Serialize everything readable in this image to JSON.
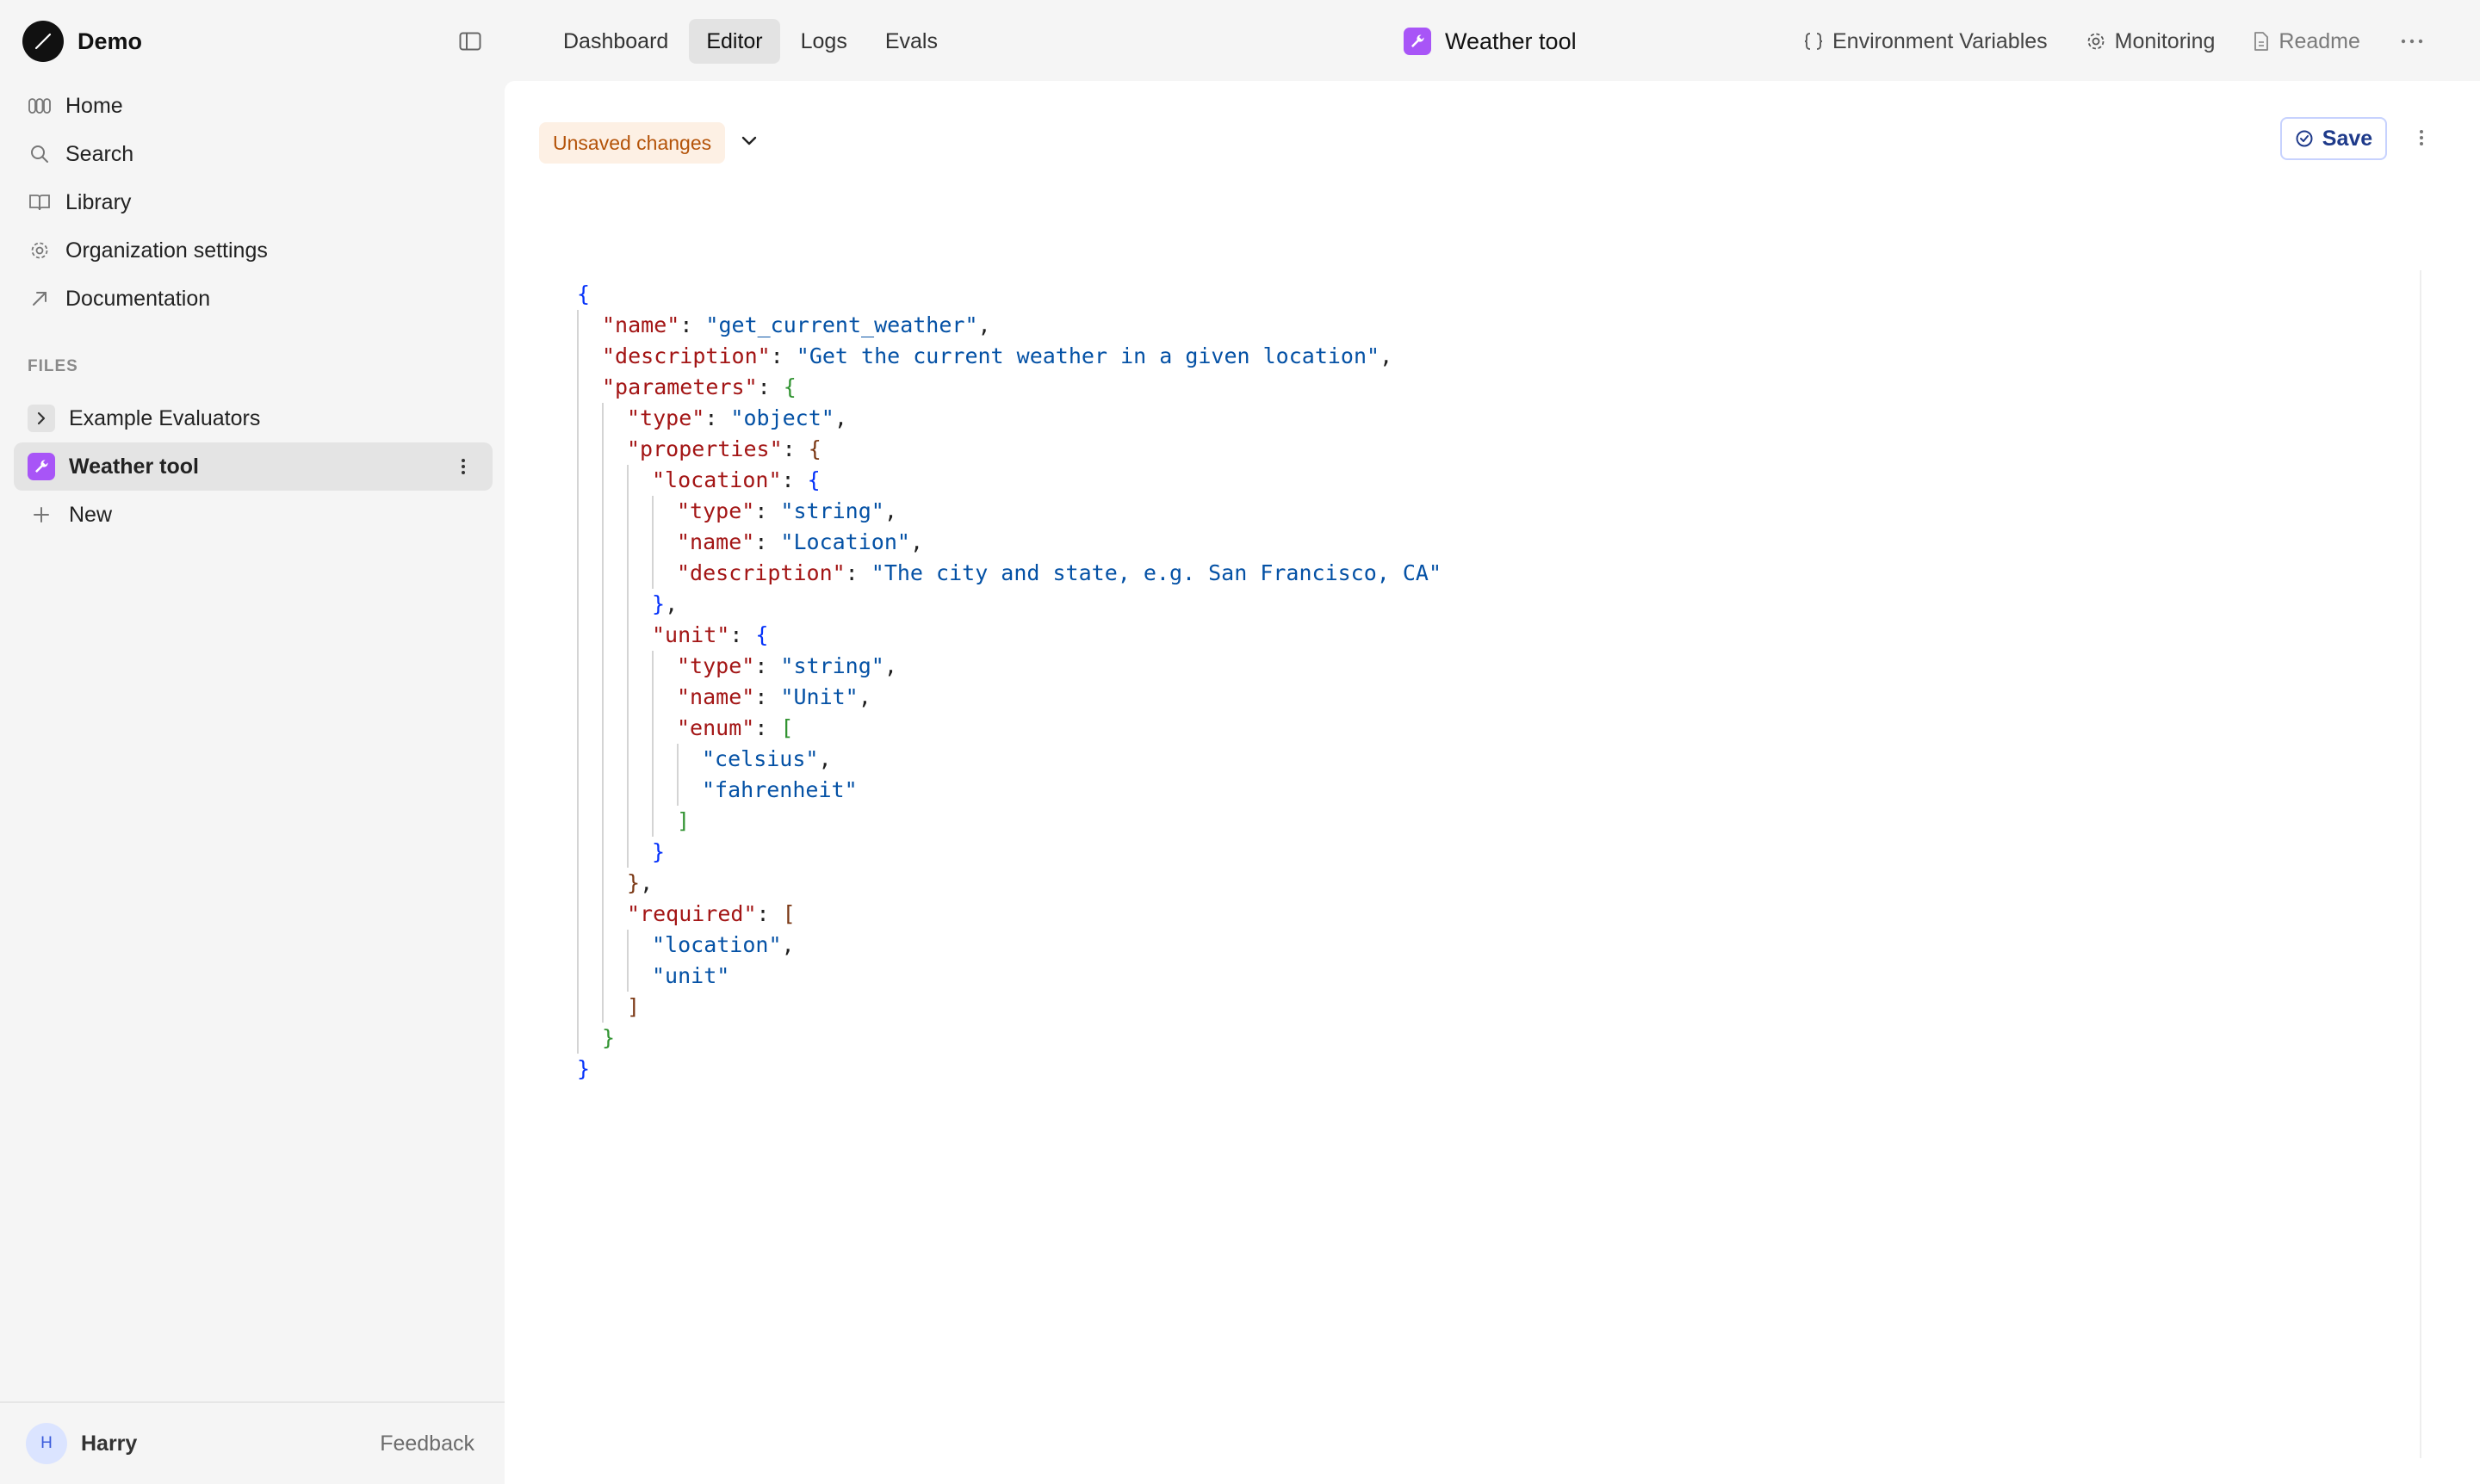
{
  "app": {
    "name": "Demo"
  },
  "sidebar": {
    "nav": [
      {
        "label": "Home",
        "icon": "home-icon"
      },
      {
        "label": "Search",
        "icon": "search-icon"
      },
      {
        "label": "Library",
        "icon": "book-icon"
      },
      {
        "label": "Organization settings",
        "icon": "gear-icon"
      },
      {
        "label": "Documentation",
        "icon": "external-arrow-icon"
      }
    ],
    "files_heading": "FILES",
    "files": [
      {
        "label": "Example Evaluators",
        "icon": "chevron-right-icon"
      },
      {
        "label": "Weather tool",
        "icon": "wrench-icon",
        "active": true
      },
      {
        "label": "New",
        "icon": "plus-icon"
      }
    ],
    "user": {
      "initial": "H",
      "name": "Harry"
    },
    "feedback_label": "Feedback"
  },
  "topbar": {
    "tabs": [
      "Dashboard",
      "Editor",
      "Logs",
      "Evals"
    ],
    "active_tab": "Editor",
    "doc_title": "Weather tool",
    "actions": [
      {
        "label": "Environment Variables",
        "icon": "braces-icon"
      },
      {
        "label": "Monitoring",
        "icon": "gear-icon"
      },
      {
        "label": "Readme",
        "icon": "document-icon"
      }
    ]
  },
  "editor": {
    "status_badge": "Unsaved changes",
    "save_label": "Save",
    "lines": [
      [
        [
          "b1",
          "{"
        ]
      ],
      [
        [
          "k",
          "\"name\""
        ],
        [
          "p",
          ": "
        ],
        [
          "s",
          "\"get_current_weather\""
        ],
        [
          "p",
          ","
        ]
      ],
      [
        [
          "k",
          "\"description\""
        ],
        [
          "p",
          ": "
        ],
        [
          "s",
          "\"Get the current weather in a given location\""
        ],
        [
          "p",
          ","
        ]
      ],
      [
        [
          "k",
          "\"parameters\""
        ],
        [
          "p",
          ": "
        ],
        [
          "b2",
          "{"
        ]
      ],
      [
        [
          "k",
          "\"type\""
        ],
        [
          "p",
          ": "
        ],
        [
          "s",
          "\"object\""
        ],
        [
          "p",
          ","
        ]
      ],
      [
        [
          "k",
          "\"properties\""
        ],
        [
          "p",
          ": "
        ],
        [
          "b3",
          "{"
        ]
      ],
      [
        [
          "k",
          "\"location\""
        ],
        [
          "p",
          ": "
        ],
        [
          "b1",
          "{"
        ]
      ],
      [
        [
          "k",
          "\"type\""
        ],
        [
          "p",
          ": "
        ],
        [
          "s",
          "\"string\""
        ],
        [
          "p",
          ","
        ]
      ],
      [
        [
          "k",
          "\"name\""
        ],
        [
          "p",
          ": "
        ],
        [
          "s",
          "\"Location\""
        ],
        [
          "p",
          ","
        ]
      ],
      [
        [
          "k",
          "\"description\""
        ],
        [
          "p",
          ": "
        ],
        [
          "s",
          "\"The city and state, e.g. San Francisco, CA\""
        ]
      ],
      [
        [
          "b1",
          "}"
        ],
        [
          "p",
          ","
        ]
      ],
      [
        [
          "k",
          "\"unit\""
        ],
        [
          "p",
          ": "
        ],
        [
          "b1",
          "{"
        ]
      ],
      [
        [
          "k",
          "\"type\""
        ],
        [
          "p",
          ": "
        ],
        [
          "s",
          "\"string\""
        ],
        [
          "p",
          ","
        ]
      ],
      [
        [
          "k",
          "\"name\""
        ],
        [
          "p",
          ": "
        ],
        [
          "s",
          "\"Unit\""
        ],
        [
          "p",
          ","
        ]
      ],
      [
        [
          "k",
          "\"enum\""
        ],
        [
          "p",
          ": "
        ],
        [
          "b2",
          "["
        ]
      ],
      [
        [
          "s",
          "\"celsius\""
        ],
        [
          "p",
          ","
        ]
      ],
      [
        [
          "s",
          "\"fahrenheit\""
        ]
      ],
      [
        [
          "b2",
          "]"
        ]
      ],
      [
        [
          "b1",
          "}"
        ]
      ],
      [
        [
          "b3",
          "}"
        ],
        [
          "p",
          ","
        ]
      ],
      [
        [
          "k",
          "\"required\""
        ],
        [
          "p",
          ": "
        ],
        [
          "b3",
          "["
        ]
      ],
      [
        [
          "s",
          "\"location\""
        ],
        [
          "p",
          ","
        ]
      ],
      [
        [
          "s",
          "\"unit\""
        ]
      ],
      [
        [
          "b3",
          "]"
        ]
      ],
      [
        [
          "b2",
          "}"
        ]
      ],
      [
        [
          "b1",
          "}"
        ]
      ]
    ],
    "indents": [
      0,
      1,
      1,
      1,
      2,
      2,
      3,
      4,
      4,
      4,
      3,
      3,
      4,
      4,
      4,
      5,
      5,
      4,
      3,
      2,
      2,
      3,
      3,
      2,
      1,
      0
    ],
    "colors": {
      "key": "#a31515",
      "string": "#0451a5",
      "brace_blue": "#0431fa",
      "brace_green": "#319331",
      "brace_brown": "#7b3814"
    }
  },
  "colors": {
    "accent_purple": "#a855f7",
    "unsaved_bg": "#fdf0e4",
    "unsaved_text": "#b45309",
    "save_text": "#1e3a8a"
  }
}
